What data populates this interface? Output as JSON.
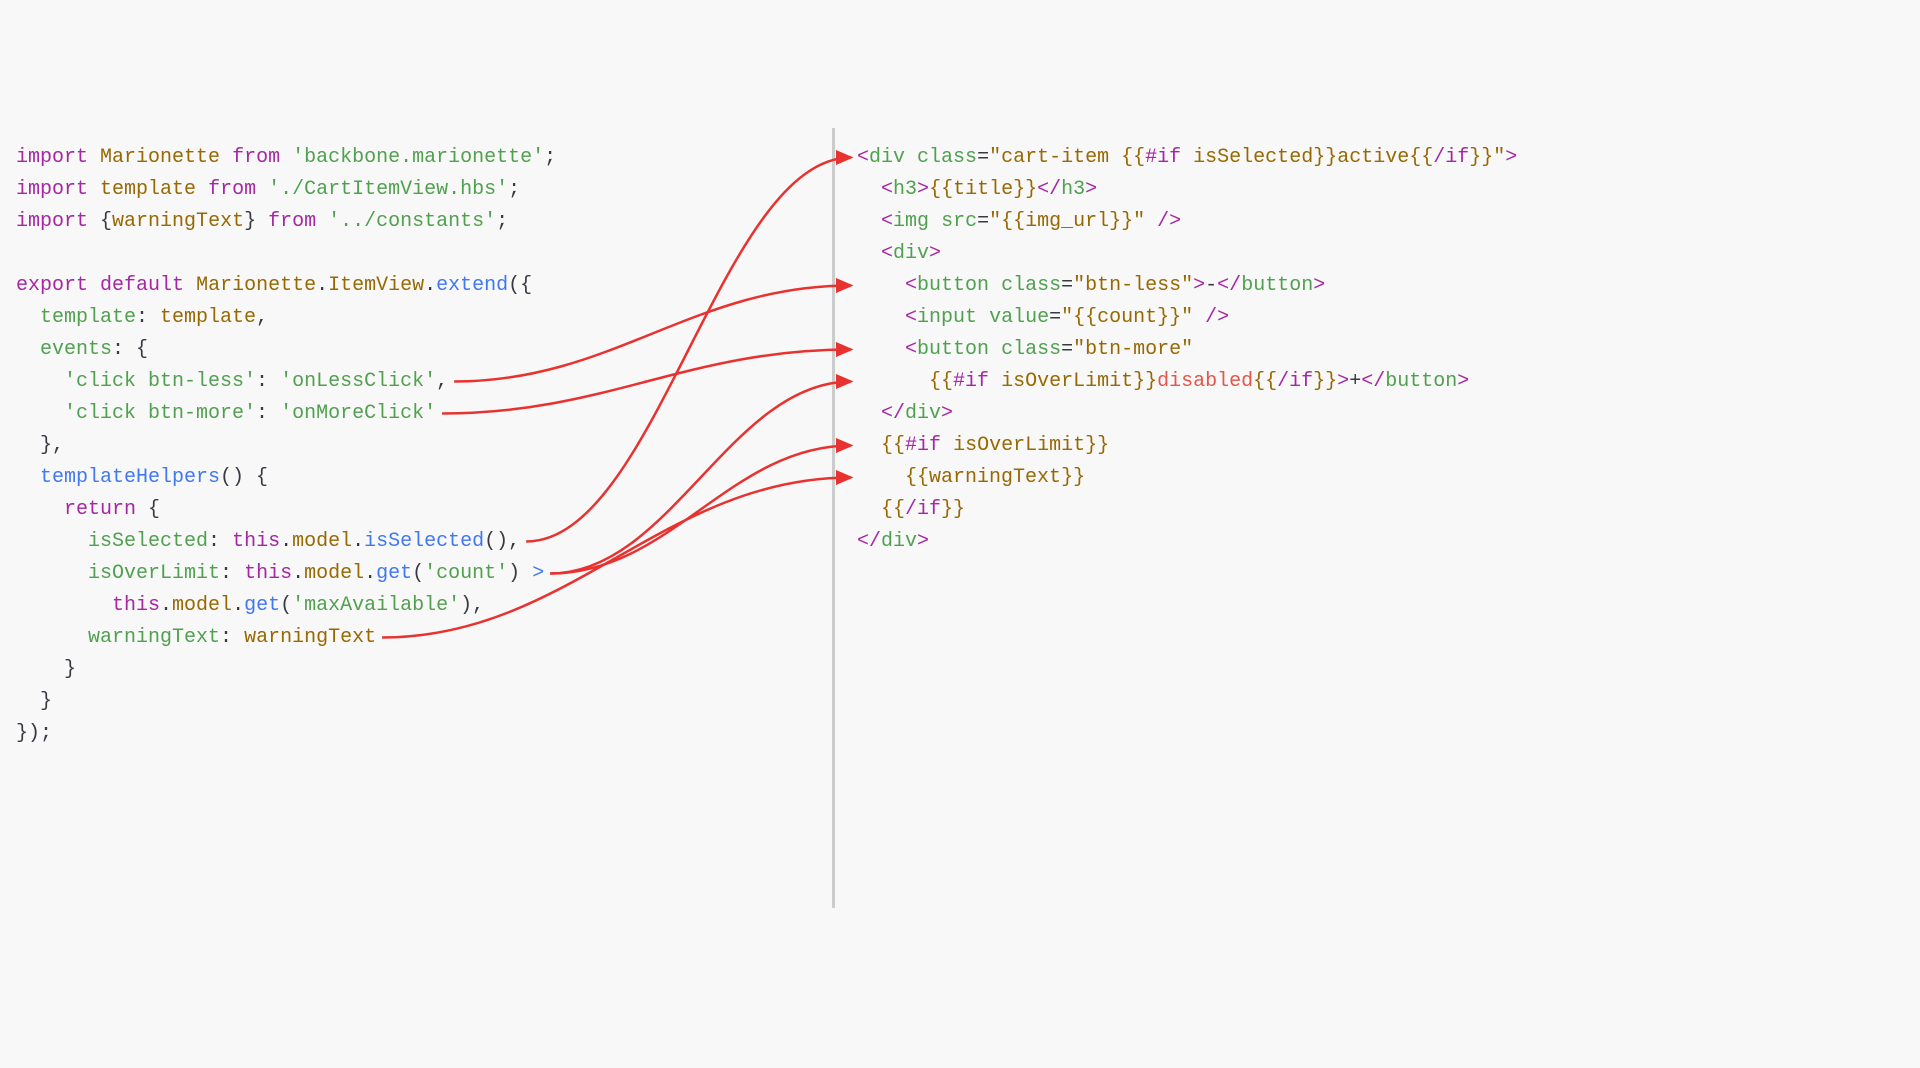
{
  "left": {
    "l1_import": "import",
    "l1_id": "Marionette",
    "l1_from": "from",
    "l1_str": "'backbone.marionette'",
    "l1_semi": ";",
    "l2_import": "import",
    "l2_id": "template",
    "l2_from": "from",
    "l2_str": "'./CartItemView.hbs'",
    "l2_semi": ";",
    "l3_import": "import",
    "l3_brace_o": "{",
    "l3_id": "warningText",
    "l3_brace_c": "}",
    "l3_from": "from",
    "l3_str": "'../constants'",
    "l3_semi": ";",
    "l5_export": "export",
    "l5_default": "default",
    "l5_mar": "Marionette",
    "l5_dot1": ".",
    "l5_iv": "ItemView",
    "l5_dot2": ".",
    "l5_extend": "extend",
    "l5_paren": "({",
    "l6_key": "template",
    "l6_colon": ": ",
    "l6_val": "template",
    "l6_comma": ",",
    "l7_key": "events",
    "l7_rest": ": {",
    "l8_key": "'click btn-less'",
    "l8_colon": ": ",
    "l8_val": "'onLessClick'",
    "l8_comma": ",",
    "l9_key": "'click btn-more'",
    "l9_colon": ": ",
    "l9_val": "'onMoreClick'",
    "l10": "  },",
    "l11_fn": "templateHelpers",
    "l11_rest": "() {",
    "l12_ret": "return",
    "l12_brace": " {",
    "l13_key": "isSelected",
    "l13_colon": ": ",
    "l13_this": "this",
    "l13_dot1": ".",
    "l13_model": "model",
    "l13_dot2": ".",
    "l13_call": "isSelected",
    "l13_end": "(),",
    "l14_key": "isOverLimit",
    "l14_colon": ": ",
    "l14_this": "this",
    "l14_dot1": ".",
    "l14_model": "model",
    "l14_dot2": ".",
    "l14_get": "get",
    "l14_open": "(",
    "l14_arg": "'count'",
    "l14_close": ") ",
    "l14_gt": ">",
    "l15_this": "this",
    "l15_dot1": ".",
    "l15_model": "model",
    "l15_dot2": ".",
    "l15_get": "get",
    "l15_open": "(",
    "l15_arg": "'maxAvailable'",
    "l15_close": "),",
    "l16_key": "warningText",
    "l16_colon": ": ",
    "l16_val": "warningText",
    "l17": "    }",
    "l18": "  }",
    "l19": "});"
  },
  "right": {
    "r1_open": "<",
    "r1_tag": "div",
    "r1_sp": " ",
    "r1_attr": "class",
    "r1_eq": "=",
    "r1_q1": "\"",
    "r1_v1": "cart-item ",
    "r1_hbs_o": "{{",
    "r1_if": "#if",
    "r1_sp2": " ",
    "r1_cond": "isSelected",
    "r1_hbs_c": "}}",
    "r1_v2": "active",
    "r1_hbs_o2": "{{",
    "r1_eif": "/if",
    "r1_hbs_c2": "}}",
    "r1_q2": "\"",
    "r1_gt": ">",
    "r2_open": "<",
    "r2_tag": "h3",
    "r2_gt1": ">",
    "r2_hbs_o": "{{",
    "r2_v": "title",
    "r2_hbs_c": "}}",
    "r2_open2": "</",
    "r2_tag2": "h3",
    "r2_gt2": ">",
    "r3_open": "<",
    "r3_tag": "img",
    "r3_sp": " ",
    "r3_attr": "src",
    "r3_eq": "=",
    "r3_q1": "\"",
    "r3_hbs_o": "{{",
    "r3_v": "img_url",
    "r3_hbs_c": "}}",
    "r3_q2": "\"",
    "r3_end": " />",
    "r4_open": "<",
    "r4_tag": "div",
    "r4_gt": ">",
    "r5_open": "<",
    "r5_tag": "button",
    "r5_sp": " ",
    "r5_attr": "class",
    "r5_eq": "=",
    "r5_q1": "\"",
    "r5_v": "btn-less",
    "r5_q2": "\"",
    "r5_gt": ">",
    "r5_txt": "-",
    "r5_open2": "</",
    "r5_tag2": "button",
    "r5_gt2": ">",
    "r6_open": "<",
    "r6_tag": "input",
    "r6_sp": " ",
    "r6_attr": "value",
    "r6_eq": "=",
    "r6_q1": "\"",
    "r6_hbs_o": "{{",
    "r6_v": "count",
    "r6_hbs_c": "}}",
    "r6_q2": "\"",
    "r6_end": " />",
    "r7_open": "<",
    "r7_tag": "button",
    "r7_sp": " ",
    "r7_attr": "class",
    "r7_eq": "=",
    "r7_q1": "\"",
    "r7_v": "btn-more",
    "r7_q2": "\"",
    "r8_hbs_o": "{{",
    "r8_if": "#if",
    "r8_sp": " ",
    "r8_cond": "isOverLimit",
    "r8_hbs_c": "}}",
    "r8_dis": "disabled",
    "r8_hbs_o2": "{{",
    "r8_eif": "/if",
    "r8_hbs_c2": "}}",
    "r8_gt": ">",
    "r8_txt": "+",
    "r8_open2": "</",
    "r8_tag2": "button",
    "r8_gt2": ">",
    "r9_open": "</",
    "r9_tag": "div",
    "r9_gt": ">",
    "r10_hbs_o": "{{",
    "r10_if": "#if",
    "r10_sp": " ",
    "r10_cond": "isOverLimit",
    "r10_hbs_c": "}}",
    "r11_hbs_o": "{{",
    "r11_v": "warningText",
    "r11_hbs_c": "}}",
    "r12_hbs_o": "{{",
    "r12_eif": "/if",
    "r12_hbs_c": "}}",
    "r13_open": "</",
    "r13_tag": "div",
    "r13_gt": ">"
  },
  "arrows": [
    {
      "from": "left-l8",
      "to": "right-r5",
      "desc": "onLessClick -> btn-less button"
    },
    {
      "from": "left-l9",
      "to": "right-r7",
      "desc": "onMoreClick -> btn-more button"
    },
    {
      "from": "left-l13",
      "to": "right-r1",
      "desc": "isSelected -> class cart-item active"
    },
    {
      "from": "left-l14",
      "to": "right-r8",
      "desc": "isOverLimit -> disabled attr"
    },
    {
      "from": "left-l14",
      "to": "right-r10",
      "desc": "isOverLimit -> #if isOverLimit block"
    },
    {
      "from": "left-l16",
      "to": "right-r11",
      "desc": "warningText -> {{warningText}}"
    }
  ],
  "colors": {
    "arrow": "#e8322f"
  }
}
